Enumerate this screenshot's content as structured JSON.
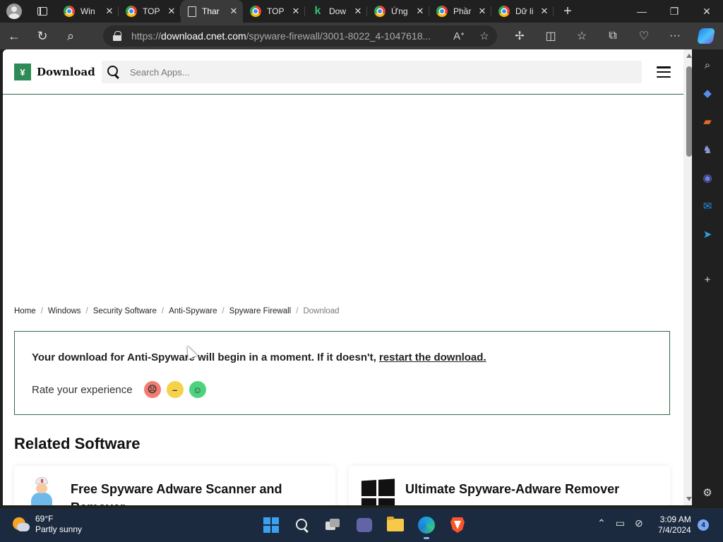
{
  "browser": {
    "tabs": [
      {
        "title": "Win",
        "icon": "chrome-icon"
      },
      {
        "title": "TOP",
        "icon": "chrome-icon"
      },
      {
        "title": "Thar",
        "icon": "document-icon",
        "active": true
      },
      {
        "title": "TOP",
        "icon": "chrome-icon"
      },
      {
        "title": "Dow",
        "icon": "k-icon"
      },
      {
        "title": "Ứng",
        "icon": "chrome-icon"
      },
      {
        "title": "Phầr",
        "icon": "chrome-icon"
      },
      {
        "title": "Dữ li",
        "icon": "chrome-icon"
      }
    ],
    "url_prefix": "https://",
    "url_domain": "download.cnet.com",
    "url_path": "/spyware-firewall/3001-8022_4-1047618..."
  },
  "site": {
    "logo_text": "Download",
    "search_placeholder": "Search Apps..."
  },
  "breadcrumb": [
    "Home",
    "Windows",
    "Security Software",
    "Anti-Spyware",
    "Spyware Firewall",
    "Download"
  ],
  "notice": {
    "message": "Your download for Anti-Spyware will begin in a moment. If it doesn't,",
    "link": "restart the download.",
    "rate_label": "Rate your experience"
  },
  "related": {
    "title": "Related Software",
    "cards": [
      {
        "title": "Free Spyware Adware Scanner and Remover"
      },
      {
        "title": "Ultimate Spyware-Adware Remover"
      }
    ]
  },
  "taskbar": {
    "temperature": "69°F",
    "weather": "Partly sunny",
    "time": "3:09 AM",
    "date": "7/4/2024",
    "notifications": "4"
  },
  "colors": {
    "brand_green": "#2e8b57",
    "border_green": "#2e6b4a",
    "taskbar_bg": "#1c2a3f"
  }
}
